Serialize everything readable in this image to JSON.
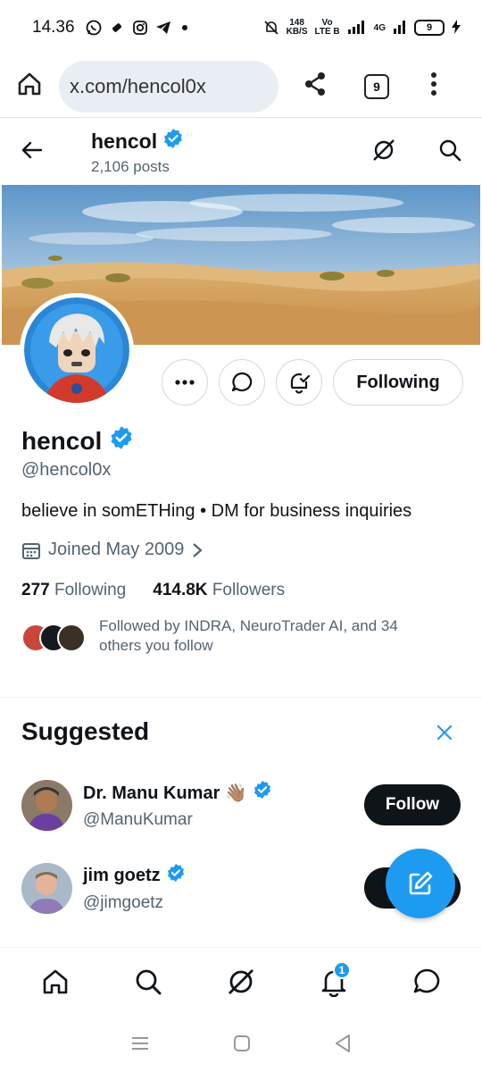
{
  "status_bar": {
    "time": "14.36",
    "net_speed_value": "148",
    "net_speed_unit": "KB/S",
    "volte_top": "Vo",
    "volte_bottom": "LTE B",
    "signal_label": "4G",
    "battery": "9"
  },
  "browser": {
    "url": "x.com/hencol0x",
    "tab_count": "9"
  },
  "profile_header": {
    "name": "hencol",
    "posts": "2,106 posts"
  },
  "profile": {
    "name": "hencol",
    "handle": "@hencol0x",
    "bio": "believe in somETHing • DM for business inquiries",
    "joined": "Joined May 2009",
    "following_count": "277",
    "following_label": "Following",
    "followers_count": "414.8K",
    "followers_label": "Followers",
    "followed_by": "Followed by INDRA, NeuroTrader AI, and 34 others you follow",
    "following_button": "Following"
  },
  "suggested": {
    "title": "Suggested",
    "items": [
      {
        "name": "Dr. Manu Kumar 👋🏽",
        "handle": "@ManuKumar",
        "button": "Follow"
      },
      {
        "name": "jim goetz",
        "handle": "@jimgoetz",
        "button": "Follow"
      }
    ]
  },
  "bottom_nav": {
    "notifications_badge": "1"
  },
  "colors": {
    "accent": "#1d9bf0",
    "text_primary": "#0f1419",
    "text_secondary": "#536471",
    "border": "#cfd9de"
  }
}
